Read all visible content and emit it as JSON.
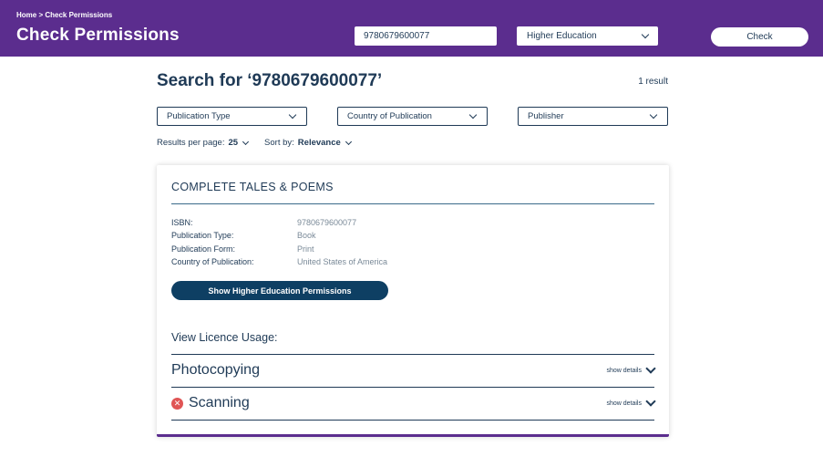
{
  "header": {
    "breadcrumb": "Home > Check Permissions",
    "title": "Check Permissions",
    "search_value": "9780679600077",
    "sector": "Higher Education",
    "check_label": "Check",
    "bg_color": "#5b2d8e"
  },
  "results": {
    "heading": "Search for ‘9780679600077’",
    "count": "1 result",
    "filters": [
      {
        "label": "Publication Type"
      },
      {
        "label": "Country of Publication"
      },
      {
        "label": "Publisher"
      }
    ],
    "per_page_label": "Results per page:",
    "per_page_value": "25",
    "sort_label": "Sort by:",
    "sort_value": "Relevance"
  },
  "card": {
    "title": "COMPLETE TALES & POEMS",
    "details": [
      {
        "key": "ISBN:",
        "value": "9780679600077"
      },
      {
        "key": "Publication Type:",
        "value": "Book"
      },
      {
        "key": "Publication Form:",
        "value": "Print"
      },
      {
        "key": "Country of Publication:",
        "value": "United States of America"
      }
    ],
    "permissions_button": "Show Higher Education Permissions",
    "usage_label": "View Licence Usage:",
    "usages": [
      {
        "name": "Photocopying",
        "status_icon": "",
        "details_label": "show details"
      },
      {
        "name": "Scanning",
        "status_icon": "error-x-icon",
        "details_label": "show details"
      }
    ],
    "accent_color": "#5b2d8e",
    "button_color": "#0e3f63",
    "error_color": "#e05555"
  }
}
